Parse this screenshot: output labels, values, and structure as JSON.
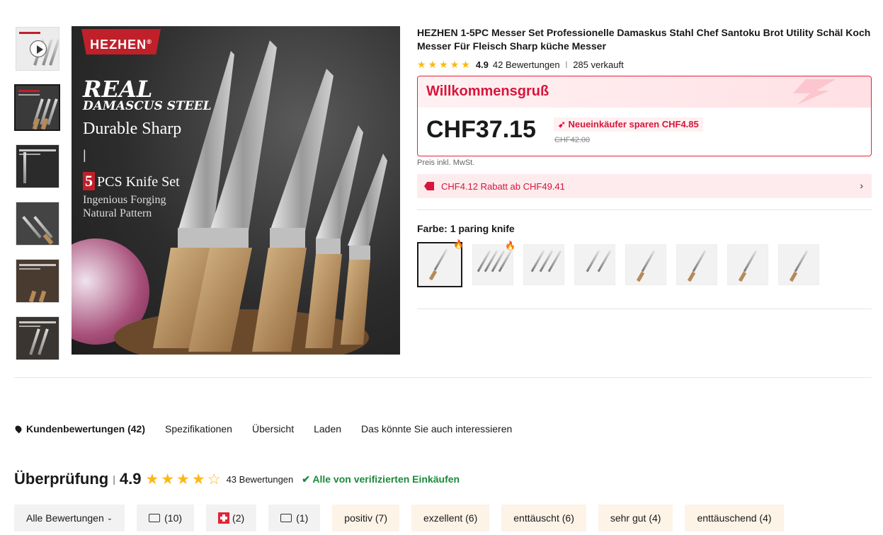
{
  "product": {
    "title": "HEZHEN 1-5PC Messer Set Professionelle Damaskus Stahl Chef Santoku Brot Utility Schäl Koch Messer Für Fleisch Sharp küche Messer",
    "rating": "4.9",
    "reviews": "42 Bewertungen",
    "sold": "285 verkauft"
  },
  "image": {
    "brand": "HEZHEN",
    "brand_mark": "®",
    "line1": "REAL",
    "line2": "DAMASCUS STEEL",
    "line3": "Durable Sharp",
    "pipe": "|",
    "pcs_num": "5",
    "pcs_text": "PCS Knife Set",
    "line5": "Ingenious Forging",
    "line6": "Natural Pattern"
  },
  "welcome": {
    "title": "Willkommensgruß",
    "price": "CHF37.15",
    "save": "Neueinkäufer sparen CHF4.85",
    "old_price": "CHF42.00",
    "vat": "Preis inkl. MwSt."
  },
  "coupon": {
    "text": "CHF4.12 Rabatt ab CHF49.41",
    "chevron": "›"
  },
  "color": {
    "label": "Farbe:",
    "value": "1 paring knife"
  },
  "tabs": [
    {
      "label": "Kundenbewertungen (42)"
    },
    {
      "label": "Spezifikationen"
    },
    {
      "label": "Übersicht"
    },
    {
      "label": "Laden"
    },
    {
      "label": "Das könnte Sie auch interessieren"
    }
  ],
  "reviews": {
    "title": "Überprüfung",
    "sep": "|",
    "score": "4.9",
    "count": "43 Bewertungen",
    "verified": "✔ Alle von verifizierten Einkäufen"
  },
  "chips": {
    "all": "Alle Bewertungen",
    "photos": "(10)",
    "country": "(2)",
    "comments": "(1)",
    "positive": "positiv (7)",
    "excellent": "exzellent (6)",
    "disappointed": "enttäuscht (6)",
    "very_good": "sehr gut (4)",
    "disappointing": "enttäuschend (4)"
  },
  "colors": {
    "accent": "#d6163c",
    "star": "#fdb813",
    "verified": "#1a8a3a"
  }
}
